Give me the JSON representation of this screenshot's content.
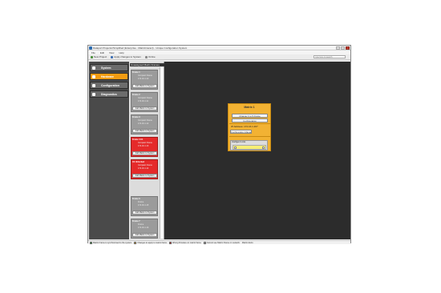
{
  "window": {
    "title": "Dataport Projector/Simplified (Enterprise - MatrixInteract) - Unique Configuration System"
  },
  "menu": [
    "File",
    "Edit",
    "View",
    "Help"
  ],
  "toolbar": {
    "new_project": "New Project",
    "apply_changes": "Apply changes to System",
    "online": "Online",
    "search_placeholder": "type here to search"
  },
  "sidebar": {
    "items": [
      {
        "label": "System",
        "icon": "system-icon"
      },
      {
        "label": "Hardware",
        "icon": "hardware-icon",
        "active": true
      },
      {
        "label": "Configuration",
        "icon": "configuration-icon"
      },
      {
        "label": "Diagnostics",
        "icon": "diagnostics-icon"
      }
    ]
  },
  "unassigned": {
    "header": "Unassigned Matrix Frames",
    "cards": [
      {
        "name": "Frame 1",
        "type": "Compact Frame",
        "ip": "172.16.1.10",
        "button": "Add Matrix to System",
        "color": "gray"
      },
      {
        "name": "Frame 2",
        "type": "Compact Frame",
        "ip": "172.16.1.11",
        "button": "Add Matrix to System",
        "color": "gray"
      },
      {
        "name": "Frame 3",
        "type": "Compact Frame",
        "ip": "172.16.1.12",
        "button": "Add Matrix to System",
        "color": "gray"
      },
      {
        "name": "Frame 4 X1",
        "type": "Compact Frame",
        "ip": "172.16.1.13",
        "button": "Add Matrix to System",
        "color": "red"
      },
      {
        "name": "X1 Unlocked",
        "type": "Compact Frame",
        "ip": "172.16.1.14",
        "button": "Add Matrix to System",
        "color": "red"
      },
      {
        "name": "Frame 6",
        "type": "Frame",
        "ip": "172.16.1.15",
        "button": "Add Matrix to System",
        "color": "gray"
      },
      {
        "name": "Frame 7",
        "type": "Frame",
        "ip": "172.16.1.16",
        "button": "Add Matrix to System",
        "color": "gray"
      }
    ]
  },
  "matrix": {
    "title": "Matrix 1",
    "change_to": "Change 1 to 5 Frame",
    "configuration": "Configuration",
    "ip": "IP Address: 172.16.1.207",
    "config_manager": "Configuration Manager",
    "intelligent": "Intelligent Links"
  },
  "status": {
    "legend": [
      {
        "label": "Matrix Frame is synchronised to the system",
        "color": "#2e9e3a"
      },
      {
        "label": "Changes to apply to matrix frame",
        "color": "#f2b233"
      },
      {
        "label": "Wrong firmware on matrix frame",
        "color": "#e52a2a"
      },
      {
        "label": "Cannot see Matrix Frame on network",
        "color": "#bbbbbb"
      }
    ],
    "extra": "Matrix Alerts"
  }
}
